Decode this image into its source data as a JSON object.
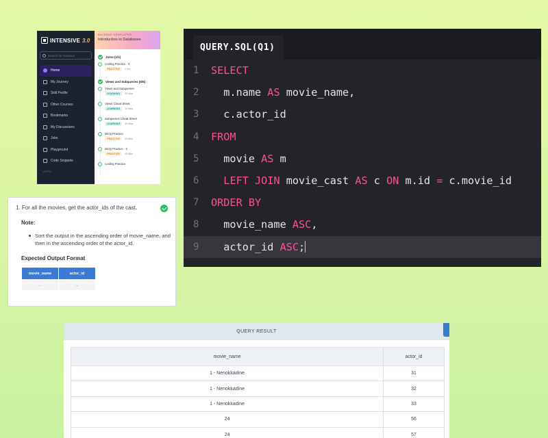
{
  "lms": {
    "brand": {
      "name": "INTENSIVE",
      "version": "3.0"
    },
    "search_placeholder": "Search for Nxtwave",
    "nav": [
      {
        "label": "Home",
        "icon": "home-icon",
        "active": true
      },
      {
        "label": "My Journey",
        "icon": "journey-icon"
      },
      {
        "label": "Skill Profile",
        "icon": "profile-icon"
      },
      {
        "label": "Other Courses",
        "icon": "courses-icon"
      },
      {
        "label": "Bookmarks",
        "icon": "bookmark-icon"
      },
      {
        "label": "My Discussions",
        "icon": "discussion-icon"
      },
      {
        "label": "Jobs",
        "icon": "jobs-icon"
      },
      {
        "label": "Playground",
        "icon": "playground-icon"
      },
      {
        "label": "Code Snippets",
        "icon": "code-icon"
      }
    ],
    "apps_label": "APPS",
    "course": {
      "category": "BACKEND DEVELOPER",
      "title": "Introduction to Databases",
      "modules": [
        {
          "title": "Joins (1/1)",
          "lessons": [
            {
              "title": "Coding Practice - 5",
              "tag": "PRACTICE",
              "duration": "2 Hrs"
            }
          ]
        },
        {
          "title": "Views and Subqueries (6/6)",
          "lessons": [
            {
              "title": "Views and Subqueries",
              "tag": "LEARNING",
              "duration": "20 Mins"
            },
            {
              "title": "Views Cheat Sheet",
              "tag": "LEARNING",
              "duration": "20 Mins"
            },
            {
              "title": "Subqueries Cheat Sheet",
              "tag": "LEARNING",
              "duration": "40 Mins"
            },
            {
              "title": "MCQ Practice",
              "tag": "PRACTICE",
              "duration": "30 Mins"
            },
            {
              "title": "MCQ Practice - 2",
              "tag": "PRACTICE",
              "duration": "30 Mins"
            },
            {
              "title": "Coding Practice",
              "tag": "",
              "duration": ""
            }
          ]
        }
      ]
    }
  },
  "question": {
    "text": "1. For all the movies, get the actor_ids of the cast.",
    "note_label": "Note:",
    "bullet": "Sort the output in the ascending order of movie_name, and then in the ascending order of the actor_id.",
    "format_label": "Expected Output Format",
    "columns": [
      "movie_name",
      "actor_id"
    ],
    "placeholder_row": [
      "...",
      "..."
    ]
  },
  "editor": {
    "tab": "QUERY.SQL(Q1)",
    "lines": [
      {
        "n": "1",
        "tokens": [
          {
            "t": "SELECT",
            "k": 1
          }
        ]
      },
      {
        "n": "2",
        "tokens": [
          {
            "t": "  m.name "
          },
          {
            "t": "AS",
            "k": 1
          },
          {
            "t": " movie_name,"
          }
        ]
      },
      {
        "n": "3",
        "tokens": [
          {
            "t": "  c.actor_id"
          }
        ]
      },
      {
        "n": "4",
        "tokens": [
          {
            "t": "FROM",
            "k": 1
          }
        ]
      },
      {
        "n": "5",
        "tokens": [
          {
            "t": "  movie "
          },
          {
            "t": "AS",
            "k": 1
          },
          {
            "t": " m"
          }
        ]
      },
      {
        "n": "6",
        "tokens": [
          {
            "t": "  "
          },
          {
            "t": "LEFT JOIN",
            "k": 1
          },
          {
            "t": " movie_cast "
          },
          {
            "t": "AS",
            "k": 1
          },
          {
            "t": " c "
          },
          {
            "t": "ON",
            "k": 1
          },
          {
            "t": " m.id "
          },
          {
            "t": "=",
            "k": 1
          },
          {
            "t": " c.movie_id"
          }
        ]
      },
      {
        "n": "7",
        "tokens": [
          {
            "t": "ORDER BY",
            "k": 1
          }
        ]
      },
      {
        "n": "8",
        "tokens": [
          {
            "t": "  movie_name "
          },
          {
            "t": "ASC",
            "k": 1
          },
          {
            "t": ","
          }
        ]
      },
      {
        "n": "9",
        "tokens": [
          {
            "t": "  actor_id "
          },
          {
            "t": "ASC",
            "k": 1
          },
          {
            "t": ";"
          }
        ],
        "current": true
      }
    ]
  },
  "result": {
    "title": "QUERY RESULT",
    "columns": [
      "movie_name",
      "actor_id"
    ],
    "rows": [
      [
        "1 - Nenokkadine",
        "31"
      ],
      [
        "1 - Nenokkadine",
        "32"
      ],
      [
        "1 - Nenokkadine",
        "33"
      ],
      [
        "24",
        "56"
      ],
      [
        "24",
        "57"
      ]
    ]
  },
  "colors": {
    "background": "#d9f5a4",
    "keyword": "#ff4f9a",
    "accent": "#3a7bd8",
    "success": "#2fb96a"
  }
}
